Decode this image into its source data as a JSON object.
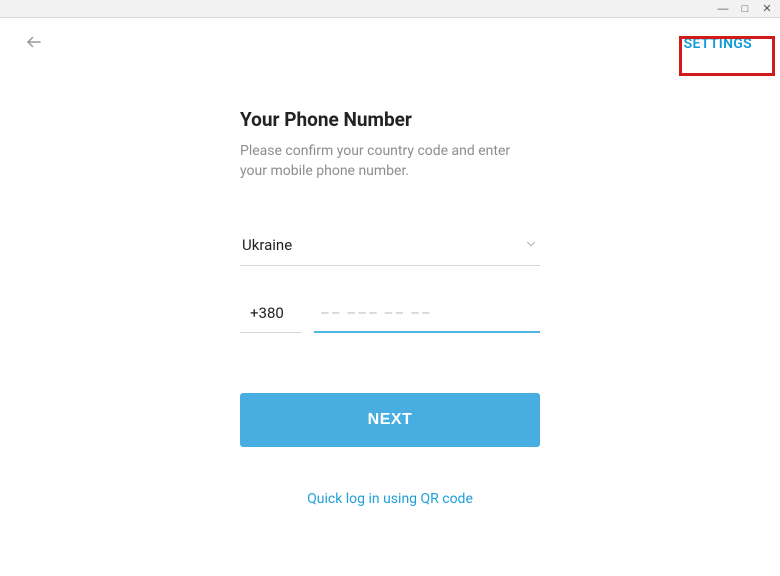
{
  "window": {
    "minimize": "—",
    "maximize": "□",
    "close": "✕"
  },
  "topbar": {
    "settings_label": "SETTINGS"
  },
  "form": {
    "title": "Your Phone Number",
    "subtitle": "Please confirm your country code and enter your mobile phone number.",
    "country_selected": "Ukraine",
    "country_code": "+380",
    "phone_value": "",
    "phone_placeholder": "–– ––– –– ––",
    "next_label": "NEXT",
    "qr_link_label": "Quick log in using QR code"
  }
}
